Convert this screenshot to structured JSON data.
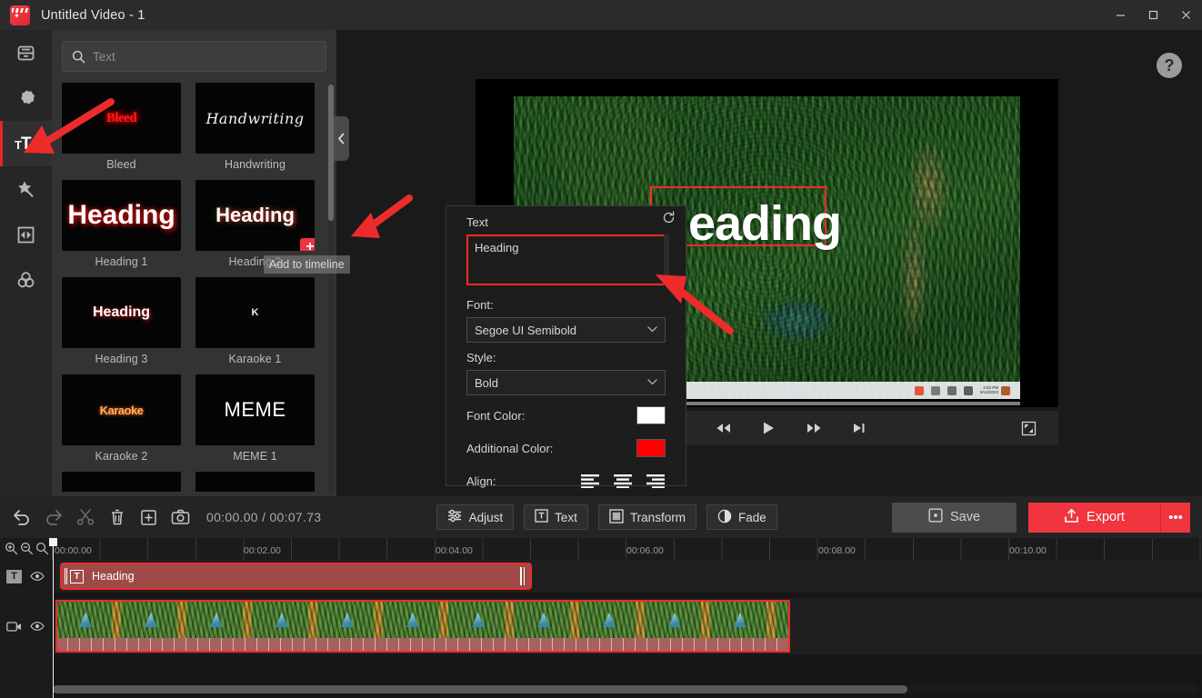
{
  "window": {
    "title": "Untitled Video - 1",
    "logo_icon": "movie-clapper-icon",
    "minimize": "minimize-icon",
    "maximize": "maximize-icon",
    "close": "close-icon"
  },
  "help": {
    "label": "?"
  },
  "sidebar": {
    "items": [
      {
        "name": "media",
        "icon": "media-import-icon"
      },
      {
        "name": "sticker",
        "icon": "sticker-octagon-icon"
      },
      {
        "name": "text",
        "icon": "text-tt-icon",
        "active": true
      },
      {
        "name": "effects",
        "icon": "magic-wand-star-icon"
      },
      {
        "name": "transitions",
        "icon": "transition-icon"
      },
      {
        "name": "filters",
        "icon": "color-circles-icon"
      }
    ]
  },
  "panel": {
    "search": {
      "placeholder": "Text",
      "value": "",
      "icon": "search-icon"
    },
    "collapse_icon": "chevron-left-icon",
    "tooltip": "Add to timeline",
    "add_badge": "+",
    "presets": [
      {
        "label": "Bleed",
        "preview": "Bleed",
        "style": "t-bleed"
      },
      {
        "label": "Handwriting",
        "preview": "Handwriting",
        "style": "t-hand"
      },
      {
        "label": "Heading 1",
        "preview": "Heading",
        "style": "t-h1"
      },
      {
        "label": "Heading 2",
        "preview": "Heading",
        "style": "t-h2"
      },
      {
        "label": "Heading 3",
        "preview": "Heading",
        "style": "t-h3"
      },
      {
        "label": "Karaoke 1",
        "preview": "K",
        "style": "t-k1"
      },
      {
        "label": "Karaoke 2",
        "preview": "Karaoke",
        "style": "t-k2"
      },
      {
        "label": "MEME 1",
        "preview": "MEME",
        "style": "t-meme"
      }
    ]
  },
  "preview": {
    "overlay_text": "Heading",
    "controls": {
      "rewind": "rewind-icon",
      "play": "play-icon",
      "forward": "fast-forward-icon",
      "next_frame": "next-frame-icon",
      "fullscreen": "fullscreen-icon"
    }
  },
  "dialog": {
    "reset_icon": "reset-arrow-icon",
    "text_label": "Text",
    "text_value": "Heading",
    "font_label": "Font:",
    "font_value": "Segoe UI Semibold",
    "style_label": "Style:",
    "style_value": "Bold",
    "font_color_label": "Font Color:",
    "font_color": "#ffffff",
    "additional_color_label": "Additional Color:",
    "additional_color": "#ff0000",
    "align_label": "Align:",
    "align_options": [
      "align-left-icon",
      "align-center-icon",
      "align-right-icon"
    ]
  },
  "toolbar": {
    "undo": "undo-icon",
    "redo": "redo-icon",
    "cut": "scissors-icon",
    "delete": "trash-icon",
    "crop": "crop-icon",
    "snapshot": "camera-icon",
    "time": "00:00.00 / 00:07.73",
    "adjust_label": "Adjust",
    "adjust_icon": "sliders-icon",
    "text_label": "Text",
    "text_icon": "text-box-icon",
    "transform_label": "Transform",
    "transform_icon": "transform-icon",
    "fade_label": "Fade",
    "fade_icon": "fade-circle-icon",
    "save_label": "Save",
    "save_icon": "save-disk-icon",
    "export_label": "Export",
    "export_icon": "export-upload-icon",
    "more_label": "•••"
  },
  "timeline": {
    "zoom_in": "zoom-in-icon",
    "zoom_out": "zoom-out-icon",
    "zoom_fit": "zoom-fit-icon",
    "ruler_labels": [
      "00:00.00",
      "00:02.00",
      "00:04.00",
      "00:06.00",
      "00:08.00",
      "00:10.00"
    ],
    "text_track": {
      "icon": "text-track-icon",
      "eye_icon": "eye-visible-icon",
      "clip_label": "Heading",
      "clip_icon": "text-clip-icon"
    },
    "video_track": {
      "icon": "video-track-icon",
      "eye_icon": "eye-visible-icon"
    }
  },
  "colors": {
    "accent": "#f0353f",
    "clip_red": "#ef2b2b",
    "panel_bg": "#333333",
    "toolbar_bg": "#242424",
    "annotation_arrow": "#ee2b2b"
  }
}
